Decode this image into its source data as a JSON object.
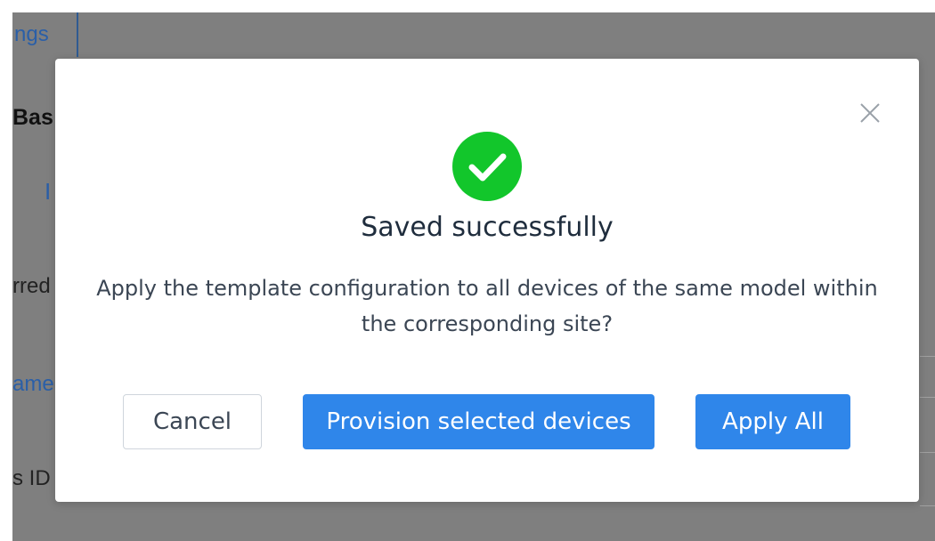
{
  "background": {
    "tab_label": "ngs",
    "heading": "Bas",
    "bar_glyph": "I",
    "label_1": "rred",
    "label_2": "ame",
    "label_3": "s ID"
  },
  "dialog": {
    "close_icon": "close-icon",
    "status_icon": "success-check-icon",
    "title": "Saved successfully",
    "message": "Apply the template configuration to all devices of the same model within the corresponding site?",
    "buttons": {
      "cancel": "Cancel",
      "provision": "Provision selected devices",
      "apply_all": "Apply All"
    }
  },
  "colors": {
    "primary": "#2f86ea",
    "success": "#12c62b",
    "overlay": "#7f7f7f"
  }
}
